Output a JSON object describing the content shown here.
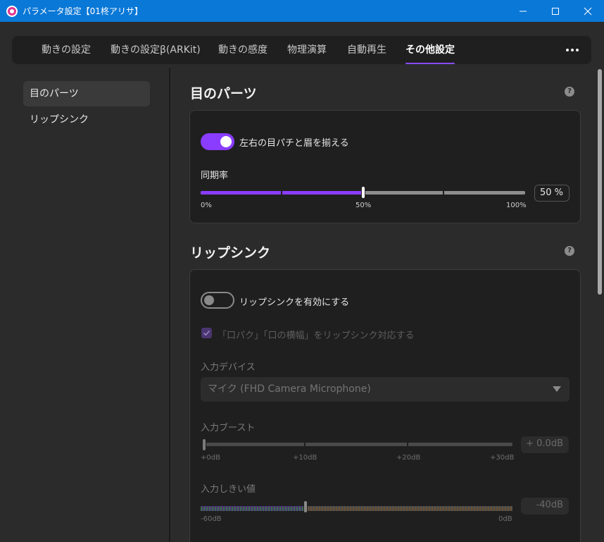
{
  "window": {
    "title": "パラメータ設定【01柊アリサ】",
    "icon": "app-logo-icon",
    "controls": [
      "minimize-icon",
      "maximize-icon",
      "close-icon"
    ]
  },
  "tabs": [
    {
      "label": "動きの設定",
      "active": false
    },
    {
      "label": "動きの設定β(ARKit)",
      "active": false
    },
    {
      "label": "動きの感度",
      "active": false
    },
    {
      "label": "物理演算",
      "active": false
    },
    {
      "label": "自動再生",
      "active": false
    },
    {
      "label": "その他設定",
      "active": true
    }
  ],
  "more_icon": "more-horizontal-icon",
  "sidebar": {
    "items": [
      {
        "label": "目のパーツ",
        "active": true
      },
      {
        "label": "リップシンク",
        "active": false
      }
    ]
  },
  "eye_section": {
    "title": "目のパーツ",
    "help": "?",
    "toggle_label": "左右の目パチと眉を揃える",
    "toggle_on": true,
    "slider_label": "同期率",
    "slider_value_percent": 50,
    "slider_display": "50 %",
    "ticks": [
      "0%",
      "50%",
      "100%"
    ]
  },
  "lip_section": {
    "title": "リップシンク",
    "help": "?",
    "toggle_label": "リップシンクを有効にする",
    "toggle_on": false,
    "checkbox_label": "「口パク」「口の横幅」をリップシンク対応する",
    "checkbox_checked": true,
    "device_label": "入力デバイス",
    "device_value": "マイク (FHD Camera Microphone)",
    "boost_label": "入力ブースト",
    "boost_display": "+  0.0dB",
    "boost_value_db": 0,
    "boost_ticks": [
      "+0dB",
      "+10dB",
      "+20dB",
      "+30dB"
    ],
    "threshold_label": "入力しきい値",
    "threshold_display": "-40dB",
    "threshold_value_db": -40,
    "threshold_ticks": [
      "-60dB",
      "0dB"
    ]
  },
  "colors": {
    "accent": "#8a3cff",
    "titlebar": "#0a78d7",
    "background": "#2b2b2b",
    "card": "#1f1f1f"
  }
}
